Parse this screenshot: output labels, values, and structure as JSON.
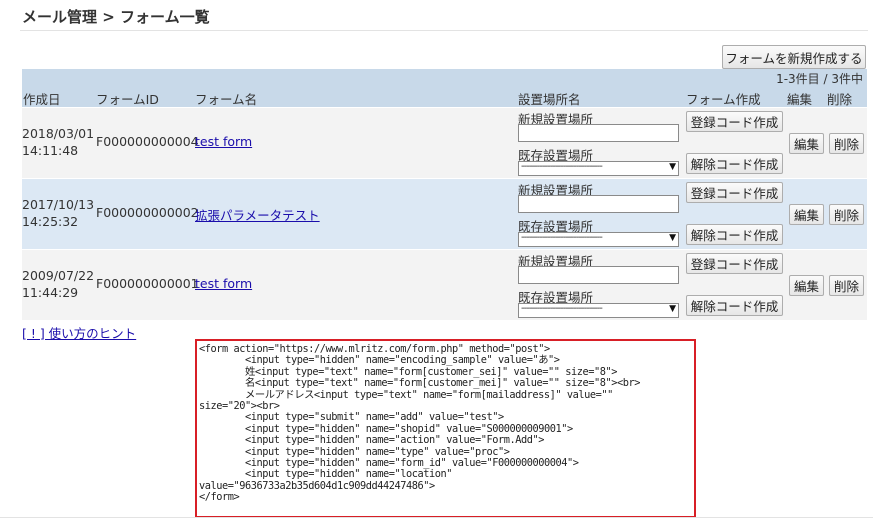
{
  "page": {
    "title": "メール管理 > フォーム一覧",
    "new_form_button": "フォームを新規作成する",
    "count_label": "1-3件目 / 3件中",
    "hint_link": "[ ! ] 使い方のヒント"
  },
  "table": {
    "columns": {
      "created": "作成日",
      "form_id": "フォームID",
      "form_name": "フォーム名",
      "location": "設置場所名",
      "create_form": "フォーム作成",
      "edit": "編集",
      "delete": "削除"
    },
    "rows": [
      {
        "date": "2018/03/01",
        "time": "14:11:48",
        "form_id": "F000000000004",
        "form_name": "test form"
      },
      {
        "date": "2017/10/13",
        "time": "14:25:32",
        "form_id": "F000000000002",
        "form_name": "拡張パラメータテスト"
      },
      {
        "date": "2009/07/22",
        "time": "11:44:29",
        "form_id": "F000000000001",
        "form_name": "test form"
      }
    ],
    "new_location_label": "新規設置場所",
    "existing_location_label": "既存設置場所",
    "select_default": "-------------------------------",
    "register_code_button": "登録コード作成",
    "unregister_code_button": "解除コード作成",
    "edit_button": "編集",
    "delete_button": "削除"
  },
  "code_snippet": {
    "lines": [
      "<form action=\"https://www.mlritz.com/form.php\" method=\"post\">",
      "        <input type=\"hidden\" name=\"encoding_sample\" value=\"あ\">",
      "        姓<input type=\"text\" name=\"form[customer_sei]\" value=\"\" size=\"8\">",
      "        名<input type=\"text\" name=\"form[customer_mei]\" value=\"\" size=\"8\"><br>",
      "        メールアドレス<input type=\"text\" name=\"form[mailaddress]\" value=\"\"",
      "size=\"20\"><br>",
      "        <input type=\"submit\" name=\"add\" value=\"test\">",
      "        <input type=\"hidden\" name=\"shopid\" value=\"S000000009001\">",
      "        <input type=\"hidden\" name=\"action\" value=\"Form.Add\">",
      "        <input type=\"hidden\" name=\"type\" value=\"proc\">",
      "        <input type=\"hidden\" name=\"form_id\" value=\"F000000000004\">",
      "        <input type=\"hidden\" name=\"location\"",
      "value=\"9636733a2b35d604d1c909dd44247486\">",
      "</form>"
    ]
  }
}
